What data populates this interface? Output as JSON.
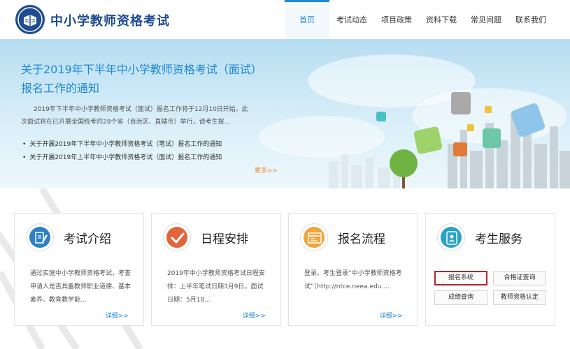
{
  "header": {
    "site_title": "中小学教师资格考试",
    "nav": [
      "首页",
      "考试动态",
      "项目政策",
      "资料下载",
      "常见问题",
      "联系我们"
    ]
  },
  "banner": {
    "title": "关于2019年下半年中小学教师资格考试（面试）报名工作的通知",
    "description": "2019年下半年中小学教师资格考试（面试）报名工作将于12月10日开始。此次面试将在已开展全国统考的28个省（自治区、直辖市）举行，请考生按...",
    "links": [
      "关于开展2019年下半年中小学教师资格考试（笔试）报名工作的通知",
      "关于开展2019年上半年中小学教师资格考试（面试）报名工作的通知"
    ],
    "more": "更多>>"
  },
  "cards": [
    {
      "title": "考试介绍",
      "text": "通过实施中小学教师资格考试，考查申请人是否具备教师职业道德、基本素养、教育教学能...",
      "more": "详细>>",
      "icon": "document-edit-icon",
      "color": "#2e7fc7"
    },
    {
      "title": "日程安排",
      "text": "2019年中小学教师资格考试日程安排：上半年笔试日期3月9日，面试日期：5月18...",
      "more": "详细>>",
      "icon": "checkmark-icon",
      "color": "#e2643a"
    },
    {
      "title": "报名流程",
      "text": "登录。考生登录“中小学教师资格考试”（http://ntce.neea.edu....",
      "more": "详细>>",
      "icon": "browser-window-icon",
      "color": "#f0a43a"
    },
    {
      "title": "考生服务",
      "icon": "contact-card-icon",
      "color": "#2aa3c9",
      "buttons": [
        "报名系统",
        "合格证查询",
        "成绩查询",
        "教师资格认定"
      ]
    }
  ]
}
